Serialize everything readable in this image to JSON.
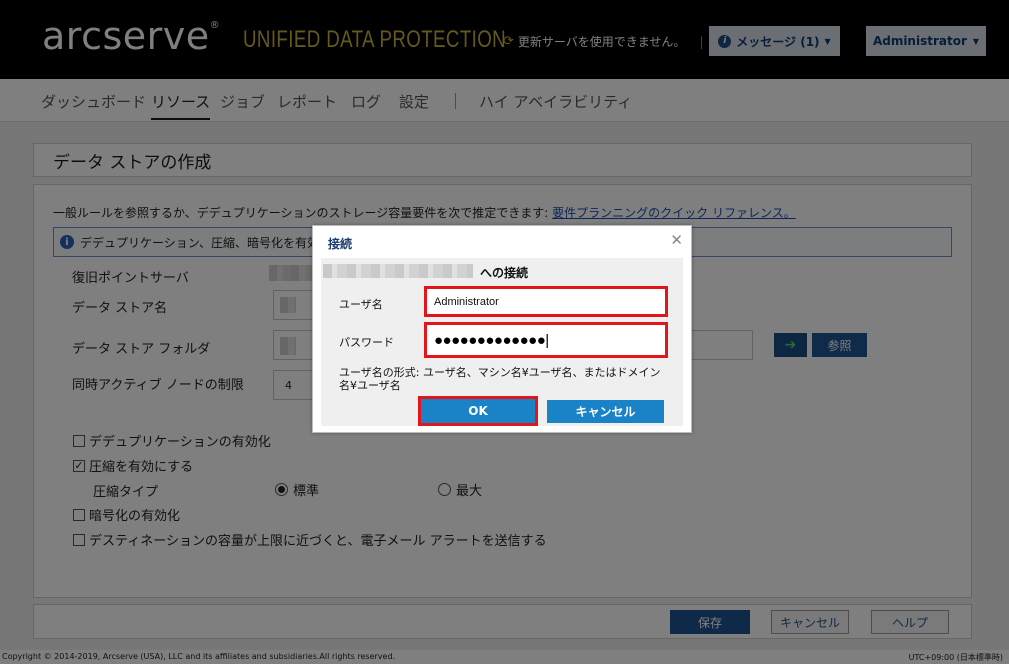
{
  "header": {
    "logo_text": "arcserve",
    "logo_mark": "®",
    "product_name": "UNIFIED DATA PROTECTION",
    "update_text": "更新サーバを使用できません。",
    "messages_label": "メッセージ (1)",
    "user_label": "Administrator",
    "accent_color": "#c8b33a"
  },
  "nav": {
    "items": [
      {
        "label": "ダッシュボード"
      },
      {
        "label": "リソース"
      },
      {
        "label": "ジョブ"
      },
      {
        "label": "レポート"
      },
      {
        "label": "ログ"
      },
      {
        "label": "設定"
      },
      {
        "label": "ハイ アベイラビリティ"
      }
    ],
    "active": "リソース"
  },
  "page": {
    "title": "データ ストアの作成",
    "intro_text": "一般ルールを参照するか、デデュプリケーションのストレージ容量要件を次で推定できます: ",
    "intro_link": "要件プランニングのクイック リファレンス。",
    "info_text": "デデュプリケーション、圧縮、暗号化を有効化また",
    "labels": {
      "rps": "復旧ポイントサーバ",
      "datastore_name": "データ ストア名",
      "datastore_folder": "データ ストア フォルダ",
      "concurrent": "同時アクティブ ノードの制限"
    },
    "concurrent_value": "4",
    "browse_label": "参照",
    "dedup_label": "デデュプリケーションの有効化",
    "dedup_checked": false,
    "compress_label": "圧縮を有効にする",
    "compress_checked": true,
    "compress_type_label": "圧縮タイプ",
    "compress_standard": "標準",
    "compress_max": "最大",
    "compress_selected": "標準",
    "encrypt_label": "暗号化の有効化",
    "encrypt_checked": false,
    "alert_label": "デスティネーションの容量が上限に近づくと、電子メール アラートを送信する",
    "alert_checked": false
  },
  "buttons": {
    "save": "保存",
    "cancel": "キャンセル",
    "help": "ヘルプ"
  },
  "status": {
    "copyright": "Copyright © 2014-2019, Arcserve (USA), LLC and its affiliates and subsidiaries.All rights reserved.",
    "timezone": "UTC+09:00 (日本標準時)"
  },
  "dialog": {
    "title": "接続",
    "connect_suffix": "への接続",
    "username_label": "ユーザ名",
    "username_value": "Administrator",
    "password_label": "パスワード",
    "password_value": "●●●●●●●●●●●●●|",
    "hint": "ユーザ名の形式: ユーザ名、マシン名¥ユーザ名、またはドメイン名¥ユーザ名",
    "ok": "OK",
    "cancel": "キャンセル"
  }
}
